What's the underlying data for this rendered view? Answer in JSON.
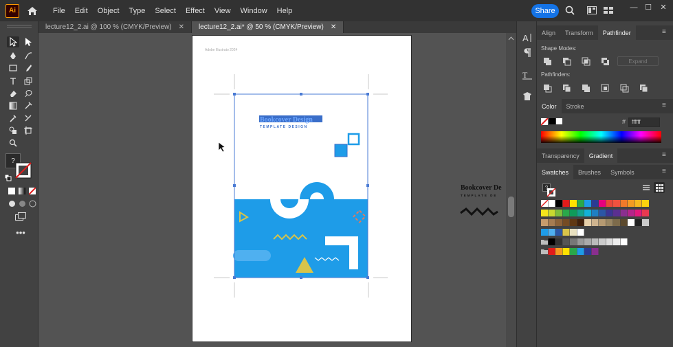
{
  "app": {
    "logo_text": "Ai"
  },
  "menu": [
    "File",
    "Edit",
    "Object",
    "Type",
    "Select",
    "Effect",
    "View",
    "Window",
    "Help"
  ],
  "share_label": "Share",
  "window_controls": {
    "minimize": "—",
    "maximize": "☐",
    "close": "✕"
  },
  "tabs": [
    {
      "label": "lecture12_2.ai @ 100 % (CMYK/Preview)",
      "close": "✕",
      "active": false
    },
    {
      "label": "lecture12_2.ai* @ 50 % (CMYK/Preview)",
      "close": "✕",
      "active": true
    }
  ],
  "artboard": {
    "label": "Adobe Illustrato 2024",
    "title_line1": "Bookcover Design",
    "title_line2": "TEMPLATE DESIGN"
  },
  "pasteboard": {
    "title": "Bookcover De",
    "subtitle": "TEMPLATE DE"
  },
  "panels": {
    "top_tabs": [
      "Align",
      "Transform",
      "Pathfinder"
    ],
    "shape_modes_label": "Shape Modes:",
    "expand_label": "Expand",
    "pathfinders_label": "Pathfinders:",
    "color_tabs": [
      "Color",
      "Stroke"
    ],
    "hex_value": "ffffff",
    "hash": "#",
    "grad_tabs": [
      "Transparency",
      "Gradient"
    ],
    "swatch_tabs": [
      "Swatches",
      "Brushes",
      "Symbols"
    ],
    "question": "?"
  },
  "colors": {
    "accent_blue": "#1e9ce8",
    "share_blue": "#1473e6",
    "yellow": "#d8c44a"
  }
}
